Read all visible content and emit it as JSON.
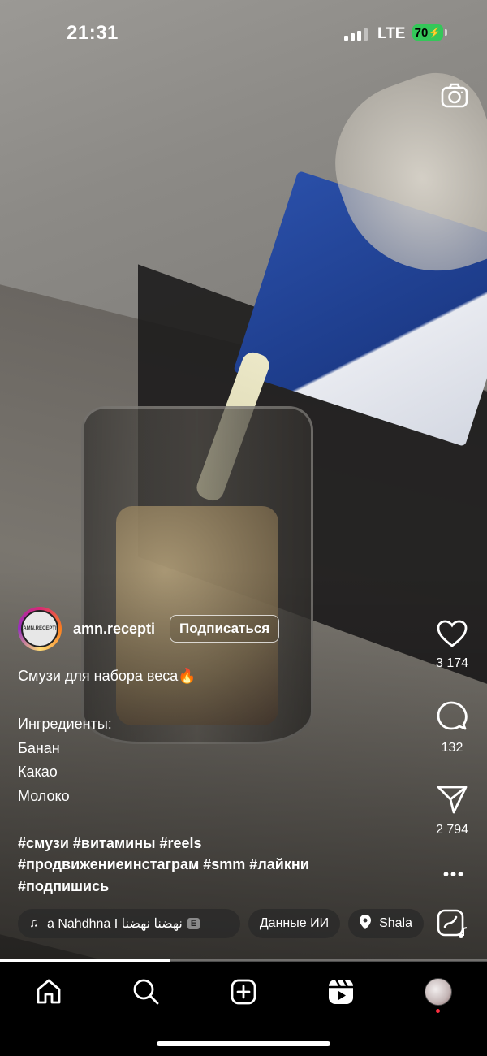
{
  "status_bar": {
    "time": "21:31",
    "network": "LTE",
    "battery": "70"
  },
  "top": {
    "camera_icon": "camera-icon"
  },
  "actions": {
    "likes": "3 174",
    "comments": "132",
    "shares": "2 794",
    "more_icon": "ellipsis-icon"
  },
  "post": {
    "avatar_text": "AMN.RECEPTI",
    "username": "amn.recepti",
    "follow_label": "Подписаться",
    "caption_lines": [
      "Смузи для набора веса🔥",
      "",
      "Ингредиенты:",
      "Банан",
      "Какао",
      "Молоко",
      ""
    ],
    "hashtag_lines": [
      " #смузи #витамины #reels",
      "#продвижениеинстаграм #smm #лайкни",
      "#подпишись"
    ]
  },
  "chips": {
    "music": "a Nahdhna I نهضنا نهضنا",
    "music_badge": "E",
    "ai": "Данные ИИ",
    "location": "Shala"
  },
  "progress": {
    "fraction": 0.35
  },
  "nav": [
    "home-icon",
    "search-icon",
    "create-icon",
    "reels-icon",
    "profile-avatar"
  ],
  "colors": {
    "battery": "#34c759",
    "notification_dot": "#ff3040"
  }
}
